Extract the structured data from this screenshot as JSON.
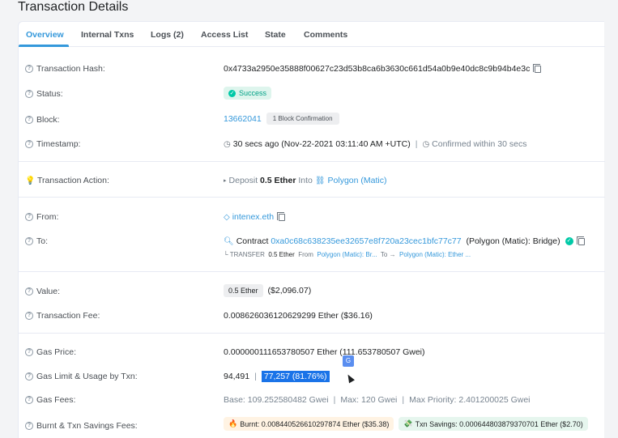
{
  "page": {
    "title": "Transaction Details"
  },
  "tabs": [
    {
      "label": "Overview"
    },
    {
      "label": "Internal Txns"
    },
    {
      "label": "Logs (2)"
    },
    {
      "label": "Access List"
    },
    {
      "label": "State"
    },
    {
      "label": "Comments"
    }
  ],
  "rows": {
    "hash": {
      "label": "Transaction Hash:",
      "value": "0x4733a2950e35888f00627c23d53b8ca6b3630c661d54a0b9e40dc8c9b94b4e3c"
    },
    "status": {
      "label": "Status:",
      "value": "Success"
    },
    "block": {
      "label": "Block:",
      "value": "13662041",
      "confirmation": "1 Block Confirmation"
    },
    "timestamp": {
      "label": "Timestamp:",
      "value": "30 secs ago (Nov-22-2021 03:11:40 AM +UTC)",
      "confirmed": "Confirmed within 30 secs"
    },
    "action": {
      "label": "Transaction Action:",
      "prefix": "Deposit",
      "amount": "0.5 Ether",
      "into": "Into",
      "target": "Polygon (Matic)"
    },
    "from": {
      "label": "From:",
      "value": "intenex.eth"
    },
    "to": {
      "label": "To:",
      "prefix": "Contract",
      "address": "0xa0c68c638235ee32657e8f720a23cec1bfc77c77",
      "name": "(Polygon (Matic): Bridge)",
      "transfer_prefix": "└ TRANSFER",
      "transfer_amount": "0.5 Ether",
      "transfer_from_label": "From",
      "transfer_from": "Polygon (Matic): Br...",
      "transfer_to_label": "To →",
      "transfer_to": "Polygon (Matic): Ether ..."
    },
    "value": {
      "label": "Value:",
      "badge": "0.5 Ether",
      "usd": "($2,096.07)"
    },
    "fee": {
      "label": "Transaction Fee:",
      "value": "0.008626036120629299 Ether ($36.16)"
    },
    "gas_price": {
      "label": "Gas Price:",
      "value": "0.000000111653780507 Ether (111.653780507 Gwei)"
    },
    "gas_limit": {
      "label": "Gas Limit & Usage by Txn:",
      "limit": "94,491",
      "usage": "77,257 (81.76%)"
    },
    "gas_fees": {
      "label": "Gas Fees:",
      "base": "Base: 109.252580482 Gwei",
      "max": "Max: 120 Gwei",
      "max_priority": "Max Priority: 2.401200025 Gwei"
    },
    "burnt": {
      "label": "Burnt & Txn Savings Fees:",
      "burnt": "Burnt: 0.008440526610297874 Ether ($35.38)",
      "savings": "Txn Savings: 0.000644803879370701 Ether ($2.70)"
    }
  },
  "colors": {
    "accent": "#3498db",
    "success": "#00a186",
    "highlight": "#1a73e8"
  }
}
